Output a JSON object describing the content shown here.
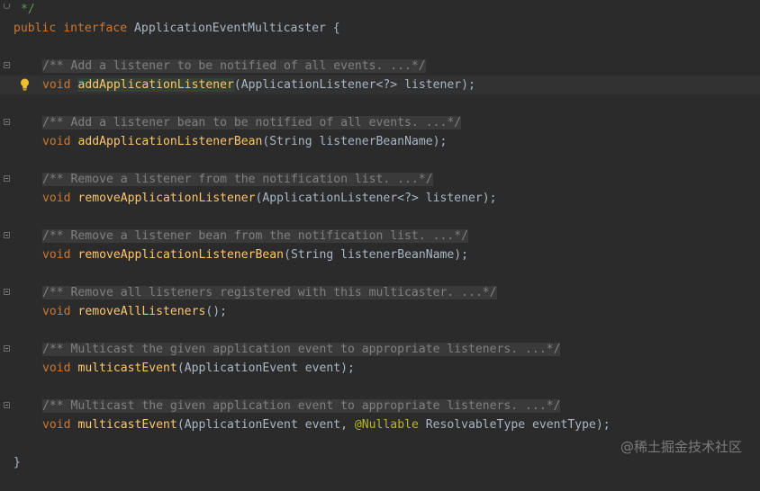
{
  "editor": {
    "comment_end": "*/",
    "interface_decl": {
      "kw_public": "public",
      "kw_interface": "interface",
      "name": "ApplicationEventMulticaster",
      "brace": "{"
    },
    "methods": [
      {
        "doc": "/** Add a listener to be notified of all events. ...*/",
        "ret": "void",
        "name": "addApplicationListener",
        "params": "(ApplicationListener<?> listener);"
      },
      {
        "doc": "/** Add a listener bean to be notified of all events. ...*/",
        "ret": "void",
        "name": "addApplicationListenerBean",
        "params": "(String listenerBeanName);"
      },
      {
        "doc": "/** Remove a listener from the notification list. ...*/",
        "ret": "void",
        "name": "removeApplicationListener",
        "params": "(ApplicationListener<?> listener);"
      },
      {
        "doc": "/** Remove a listener bean from the notification list. ...*/",
        "ret": "void",
        "name": "removeApplicationListenerBean",
        "params": "(String listenerBeanName);"
      },
      {
        "doc": "/** Remove all listeners registered with this multicaster. ...*/",
        "ret": "void",
        "name": "removeAllListeners",
        "params": "();"
      },
      {
        "doc": "/** Multicast the given application event to appropriate listeners. ...*/",
        "ret": "void",
        "name": "multicastEvent",
        "params": "(ApplicationEvent event);"
      },
      {
        "doc": "/** Multicast the given application event to appropriate listeners. ...*/",
        "ret": "void",
        "name": "multicastEvent",
        "params_a": "(ApplicationEvent event, ",
        "annotation": "@Nullable",
        "params_b": " ResolvableType eventType);"
      }
    ],
    "closing_brace": "}",
    "intention_icon": "lightbulb-icon"
  },
  "watermark": "@稀土掘金技术社区",
  "colors": {
    "background": "#2b2b2b",
    "keyword": "#cc7832",
    "method": "#ffc66d",
    "text": "#a9b7c6",
    "comment": "#808080",
    "annotation": "#bbb529"
  }
}
